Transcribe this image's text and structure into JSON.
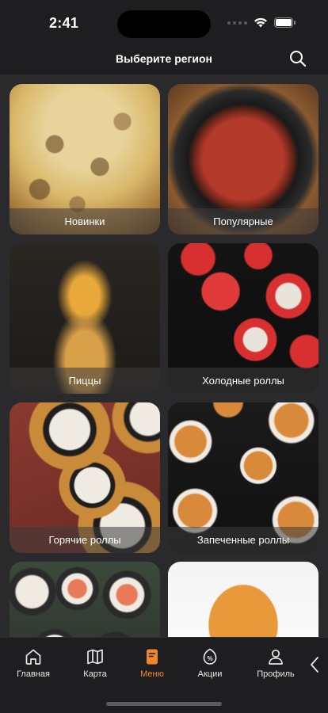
{
  "status": {
    "time": "2:41"
  },
  "header": {
    "title": "Выберите регион"
  },
  "categories": [
    {
      "label": "Новинки"
    },
    {
      "label": "Популярные"
    },
    {
      "label": "Пиццы"
    },
    {
      "label": "Холодные роллы"
    },
    {
      "label": "Горячие роллы"
    },
    {
      "label": "Запеченные роллы"
    },
    {
      "label": ""
    },
    {
      "label": ""
    }
  ],
  "tabs": [
    {
      "label": "Главная",
      "icon": "home-icon"
    },
    {
      "label": "Карта",
      "icon": "map-icon"
    },
    {
      "label": "Меню",
      "icon": "menu-icon",
      "active": true
    },
    {
      "label": "Акции",
      "icon": "discount-icon"
    },
    {
      "label": "Профиль",
      "icon": "profile-icon"
    }
  ],
  "colors": {
    "accent": "#f0882b",
    "background": "#2a2a2c",
    "bar": "#1e1e20"
  }
}
